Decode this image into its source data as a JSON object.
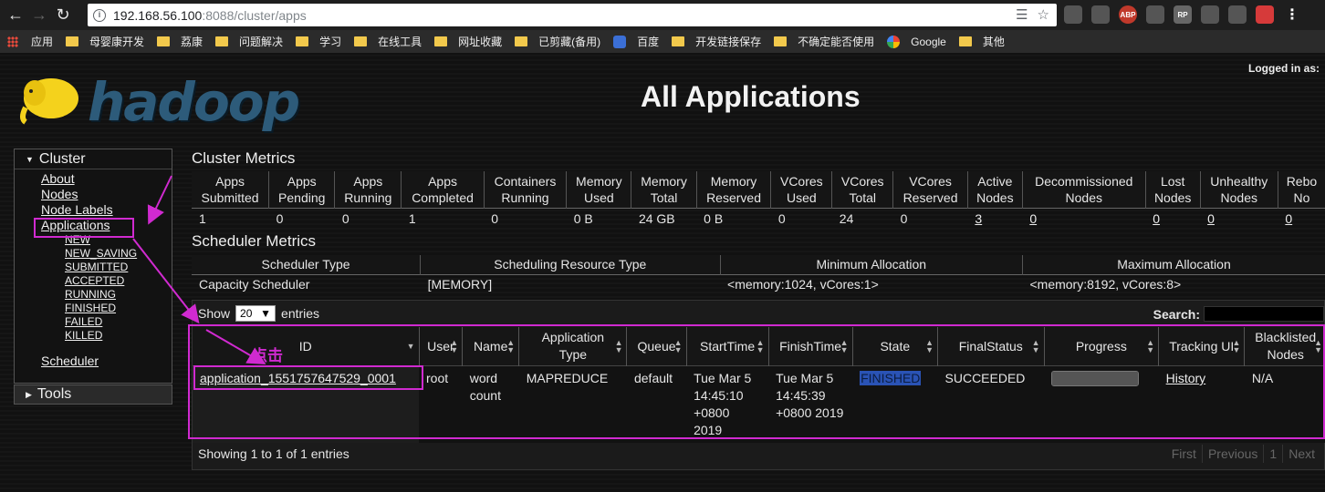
{
  "browser": {
    "url_host": "192.168.56.100",
    "url_rest": ":8088/cluster/apps",
    "bookmarks": [
      "应用",
      "母婴康开发",
      "荔康",
      "问题解决",
      "学习",
      "在线工具",
      "网址收藏",
      "已剪藏(备用)",
      "百度",
      "开发链接保存",
      "不确定能否使用",
      "Google",
      "其他"
    ],
    "extensions": [
      "ABP",
      "RP"
    ]
  },
  "header": {
    "logo_text": "hadoop",
    "title": "All Applications",
    "logged_in": "Logged in as:"
  },
  "sidebar": {
    "cluster_label": "Cluster",
    "links": [
      "About",
      "Nodes",
      "Node Labels",
      "Applications"
    ],
    "sub_links": [
      "NEW",
      "NEW_SAVING",
      "SUBMITTED",
      "ACCEPTED",
      "RUNNING",
      "FINISHED",
      "FAILED",
      "KILLED"
    ],
    "scheduler": "Scheduler",
    "tools_label": "Tools"
  },
  "cluster_metrics": {
    "title": "Cluster Metrics",
    "headers": [
      [
        "Apps",
        "Submitted"
      ],
      [
        "Apps",
        "Pending"
      ],
      [
        "Apps",
        "Running"
      ],
      [
        "Apps",
        "Completed"
      ],
      [
        "Containers",
        "Running"
      ],
      [
        "Memory",
        "Used"
      ],
      [
        "Memory",
        "Total"
      ],
      [
        "Memory",
        "Reserved"
      ],
      [
        "VCores",
        "Used"
      ],
      [
        "VCores",
        "Total"
      ],
      [
        "VCores",
        "Reserved"
      ],
      [
        "Active",
        "Nodes"
      ],
      [
        "Decommissioned",
        "Nodes"
      ],
      [
        "Lost",
        "Nodes"
      ],
      [
        "Unhealthy",
        "Nodes"
      ],
      [
        "Rebo",
        "No"
      ]
    ],
    "values": [
      "1",
      "0",
      "0",
      "1",
      "0",
      "0 B",
      "24 GB",
      "0 B",
      "0",
      "24",
      "0",
      "3",
      "0",
      "0",
      "0",
      "0"
    ],
    "link_values": [
      false,
      false,
      false,
      false,
      false,
      false,
      false,
      false,
      false,
      false,
      false,
      true,
      true,
      true,
      true,
      true
    ]
  },
  "scheduler_metrics": {
    "title": "Scheduler Metrics",
    "headers": [
      "Scheduler Type",
      "Scheduling Resource Type",
      "Minimum Allocation",
      "Maximum Allocation"
    ],
    "values": [
      "Capacity Scheduler",
      "[MEMORY]",
      "<memory:1024, vCores:1>",
      "<memory:8192, vCores:8>"
    ]
  },
  "apps_table": {
    "show_label": "Show",
    "page_size": "20",
    "entries_label": "entries",
    "search_label": "Search:",
    "headers": [
      [
        "ID"
      ],
      [
        "User"
      ],
      [
        "Name"
      ],
      [
        "Application",
        "Type"
      ],
      [
        "Queue"
      ],
      [
        "StartTime"
      ],
      [
        "FinishTime"
      ],
      [
        "State"
      ],
      [
        "FinalStatus"
      ],
      [
        "Progress"
      ],
      [
        "Tracking UI"
      ],
      [
        "Blacklisted",
        "Nodes"
      ]
    ],
    "row": {
      "id": "application_1551757647529_0001",
      "user": "root",
      "name": "word count",
      "type": "MAPREDUCE",
      "queue": "default",
      "start_time": "Tue Mar 5 14:45:10 +0800 2019",
      "finish_time": "Tue Mar 5 14:45:39 +0800 2019",
      "state": "FINISHED",
      "final_status": "SUCCEEDED",
      "progress": 100,
      "tracking_ui": "History",
      "blacklisted": "N/A"
    },
    "footer": "Showing 1 to 1 of 1 entries",
    "pager": [
      "First",
      "Previous",
      "1",
      "Next"
    ]
  },
  "annotation": {
    "label": "点击",
    "color": "#d02ad0"
  }
}
